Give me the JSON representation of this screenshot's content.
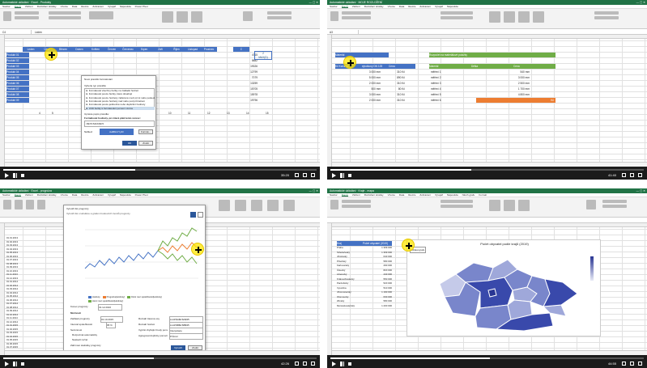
{
  "panels": [
    {
      "title": "Automatické ukládání",
      "doc": "Excel - Produkty",
      "user": "Tomáš",
      "time": "35:20",
      "progress": 0.42,
      "tabs": [
        "Soubor",
        "Domů",
        "Vložení",
        "Rozložení stránky",
        "Vzorce",
        "Data",
        "Revize",
        "Zobrazení",
        "Vývojář",
        "Nápověda",
        "Power Pivot"
      ],
      "namebox": "C4",
      "formula": "Leden",
      "cols": [
        "C",
        "D",
        "E",
        "F",
        "G",
        "H",
        "I",
        "J",
        "K",
        "L",
        "M",
        "N",
        "O",
        "P",
        "Q"
      ],
      "header": [
        "",
        "Leden",
        "Únor",
        "Březen",
        "Duben",
        "Květen",
        "Červen",
        "Červenec",
        "Srpen",
        "Září",
        "Říjen",
        "Listopad",
        "Prosinec",
        "",
        "Σ"
      ],
      "products": [
        "Produkt 01",
        "Produkt 02",
        "Produkt 03",
        "Produkt 04",
        "Produkt 05",
        "Produkt 06",
        "Produkt 07",
        "Produkt 08",
        "Produkt 09"
      ],
      "dlg": {
        "title": "Nové pravidlo formátování",
        "sec1": "Vyberte typ pravidla:",
        "rules": [
          "► Formátovat všechny buňky na základě hodnot",
          "► Formátovat pouze buňky, které obsahují",
          "► Formátovat pouze hodnoty zařazené mezi první nebo poslední",
          "► Formátovat pouze hodnoty nad nebo pod průměrem",
          "► Formátovat pouze jedinečné nebo duplicitní hodnoty",
          "► Určit buňky k formátování pomocí vzorce"
        ],
        "sec2": "Upravte popis pravidla:",
        "label": "Formátovat hodnoty, pro které platí tento vzorec:",
        "formula": "=$C5=MAX($C5",
        "preview": "Náhled:",
        "sample": "AaBbCcYyZz",
        "format": "Formát...",
        "ok": "OK",
        "cancel": "Zrušit"
      },
      "side": [
        "2",
        "MAX(D)"
      ],
      "sums": [
        "4715",
        "5882",
        "19326",
        "12799",
        "7079",
        "13259",
        "15705",
        "15978",
        "19796"
      ],
      "bottom": [
        "4",
        "5",
        "10",
        "11",
        "12",
        "13",
        "14",
        "15"
      ]
    },
    {
      "title": "Automatické ukládání",
      "doc": "MOJE ROZLOŽENÍ",
      "user": "Tomáš",
      "time": "41:40",
      "progress": 0.45,
      "tabs": [
        "Soubor",
        "Domů",
        "Vložení",
        "Rozložení stránky",
        "Vzorce",
        "Data",
        "Revize",
        "Zobrazení",
        "Vývojář",
        "Nápověda"
      ],
      "namebox": "A3",
      "formula": "",
      "h1": "Materiál",
      "h2": "Rozpočet na materiálové položky",
      "t1": [
        "Kč Korunky",
        "ejnotkový DN 125",
        "Cena"
      ],
      "t1rows": [
        [
          "3 000 mm",
          "310 Kč"
        ],
        [
          "5 000 mm",
          "890 Kč"
        ],
        [
          "2 000 mm",
          "310 Kč"
        ],
        [
          "500 mm",
          "80 Kč"
        ],
        [
          "3 000 mm",
          "310 Kč"
        ],
        [
          "2 000 mm",
          "310 Kč"
        ]
      ],
      "t2": [
        "Materiál",
        "Délka",
        "Cena"
      ],
      "t2rows": [
        [
          "měření 1",
          "",
          "540 mm"
        ],
        [
          "měření 2",
          "",
          "3 000 mm"
        ],
        [
          "měření 3",
          "",
          "2 500 mm"
        ],
        [
          "měření 4",
          "",
          "1 700 mm"
        ],
        [
          "měření 5",
          "",
          "4 800 mm"
        ],
        [
          "měření 6",
          "",
          "2 000 mm"
        ]
      ],
      "orange": "Kč"
    },
    {
      "title": "Automatické ukládání",
      "doc": "Excel - prognóza",
      "user": "Tomáš",
      "time": "42:26",
      "progress": 0.48,
      "tabs": [
        "Soubor",
        "Domů",
        "Vložení",
        "Rozložení stránky",
        "Vzorce",
        "Data",
        "Revize",
        "Zobrazení",
        "Vývojář",
        "Nápověda",
        "Power Pivot"
      ],
      "dates": [
        "01.01.2013",
        "01.02.2013",
        "01.03.2013",
        "01.04.2013",
        "01.05.2013",
        "01.06.2013",
        "01.07.2013",
        "01.08.2013",
        "01.09.2013",
        "01.10.2013",
        "01.11.2013",
        "01.12.2013",
        "01.01.2014",
        "01.02.2014",
        "01.03.2014",
        "01.04.2014",
        "01.05.2014",
        "01.06.2014",
        "01.07.2014",
        "01.08.2014",
        "01.09.2014",
        "01.10.2014",
        "01.11.2014",
        "01.12.2014",
        "01.01.2015",
        "01.02.2015",
        "01.03.2015",
        "01.04.2015",
        "01.05.2015",
        "01.06.2015",
        "01.07.2015",
        "01.08.2015",
        "01.09.2015",
        "01.10.2015",
        "01.11.2015"
      ],
      "dlg": {
        "title": "Vytvořit list prognózy",
        "sub": "Vytvořit list s tabulkou a grafem budoucích trendů prognózy",
        "opts": "Možnosti",
        "l1": "Konec prognózy",
        "v1": "31.12.2016",
        "l2": "Začátek prognózy",
        "v2": "01.10.2015",
        "l3": "Interval spolehlivosti",
        "v3": "95 %",
        "l4": "Sezónnost",
        "r1": "Rozpoznat automaticky",
        "r2": "Nastavit ručně",
        "l5": "Zahrnout statistiky prognózy",
        "k1": "Rozsah časové osy",
        "kv1": "List1!$A$2:$A$35",
        "k2": "Rozsah hodnot",
        "kv2": "List1!$B$2:$B$35",
        "k3": "Vyplnit chybějící body pomocí",
        "kv3": "Interpolace",
        "k4": "Agregovat duplicity pomocí",
        "kv4": "Průměr",
        "create": "Vytvořit",
        "cancel": "Zrušit",
        "legend": [
          "Hodnoty",
          "Prognóza(Hodnoty)",
          "Dolní mez spolehlivosti(Hodnoty)",
          "Horní mez spolehlivosti(Hodnoty)"
        ]
      }
    },
    {
      "title": "Automatické ukládání",
      "doc": "Kraje - mapa",
      "user": "Tomáš",
      "time": "44:55",
      "progress": 0.51,
      "tabs": [
        "Soubor",
        "Domů",
        "Vložení",
        "Rozložení stránky",
        "Vzorce",
        "Data",
        "Revize",
        "Zobrazení",
        "Vývojář",
        "Nápověda",
        "Návrh grafu",
        "Formát"
      ],
      "table_header": [
        "Kraj",
        "Počet obyvatel (2019)"
      ],
      "regions": [
        [
          "Praha",
          "1 309 000"
        ],
        [
          "Středočeský",
          "1 369 000"
        ],
        [
          "Jihočeský",
          "640 000"
        ],
        [
          "Plzeňský",
          "580 000"
        ],
        [
          "Karlovarský",
          "290 000"
        ],
        [
          "Ústecký",
          "820 000"
        ],
        [
          "Liberecký",
          "440 000"
        ],
        [
          "Královéhradecký",
          "550 000"
        ],
        [
          "Pardubický",
          "520 000"
        ],
        [
          "Vysočina",
          "510 000"
        ],
        [
          "Jihomoravský",
          "1 190 000"
        ],
        [
          "Olomoucký",
          "630 000"
        ],
        [
          "Zlínský",
          "580 000"
        ],
        [
          "Moravskoslezský",
          "1 200 000"
        ]
      ],
      "chart_title": "Počet obyvatel podle krajů (2019)",
      "cursor_label": "Oblast grafu"
    }
  ]
}
